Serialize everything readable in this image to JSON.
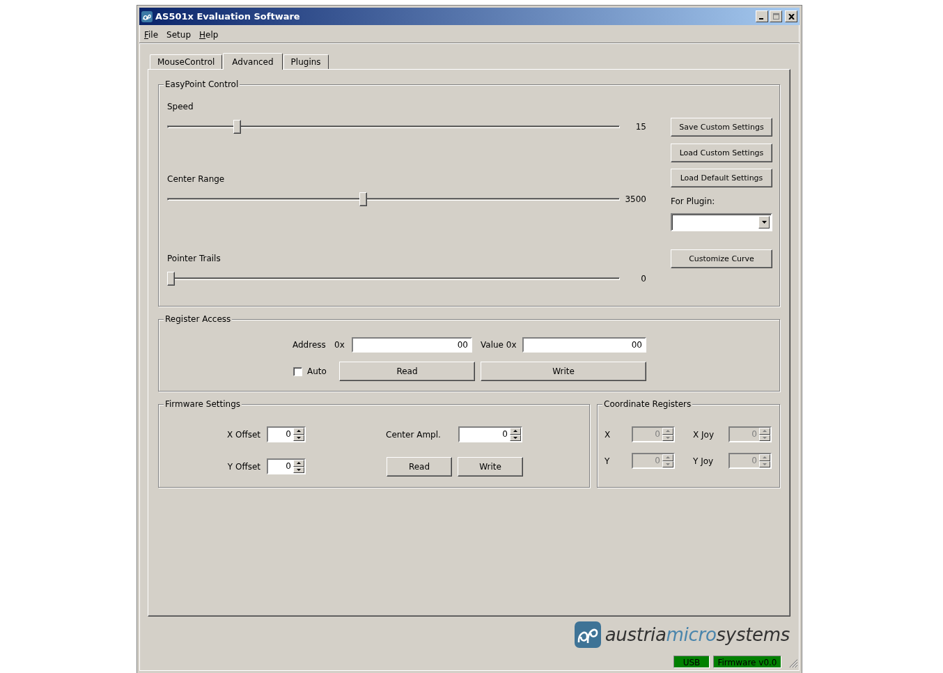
{
  "window": {
    "title": "AS501x Evaluation Software"
  },
  "menu": [
    {
      "label": "File",
      "underline_first": true
    },
    {
      "label": "Setup",
      "underline_first": false
    },
    {
      "label": "Help",
      "underline_first": true
    }
  ],
  "tabs": [
    {
      "label": "MouseControl",
      "selected": false
    },
    {
      "label": "Advanced",
      "selected": true
    },
    {
      "label": "Plugins",
      "selected": false
    }
  ],
  "easypoint": {
    "title": "EasyPoint Control",
    "sliders": [
      {
        "label": "Speed",
        "level": 0.148,
        "reading": "15"
      },
      {
        "label": "Center Range",
        "level": 0.432,
        "reading": "3500"
      },
      {
        "label": "Pointer Trails",
        "level": 0,
        "reading": "0"
      }
    ],
    "buttons": [
      "Save Custom Settings",
      "Load Custom Settings",
      "Load Default Settings"
    ],
    "plugin_label": "For Plugin:",
    "curve_button": "Customize Curve"
  },
  "register_access": {
    "title": "Register Access",
    "address_label": "Address",
    "address_prefix": "0x",
    "address_value": "00",
    "value_label": "Value 0x",
    "value_value": "00",
    "auto": {
      "label": "Auto",
      "checked": false
    },
    "read_button": "Read",
    "write_button": "Write"
  },
  "firmware": {
    "title": "Firmware Settings",
    "fields": [
      {
        "label": "X Offset",
        "value": "0",
        "disabled": false
      },
      {
        "label": "Y Offset",
        "value": "0",
        "disabled": false
      }
    ],
    "center": {
      "label": "Center Ampl.",
      "value": "0",
      "disabled": false
    },
    "read_button": "Read",
    "write_button": "Write"
  },
  "coordinates": {
    "title": "Coordinate Registers",
    "fields": [
      {
        "label": "X",
        "value": "0",
        "disabled": true
      },
      {
        "label": "X Joy",
        "value": "0",
        "disabled": true
      },
      {
        "label": "Y",
        "value": "0",
        "disabled": true
      },
      {
        "label": "Y Joy",
        "value": "0",
        "disabled": true
      }
    ]
  },
  "logo": {
    "parts": [
      "austria",
      "micro",
      "systems"
    ]
  },
  "status_bar": [
    "USB",
    "Firmware v0.0"
  ]
}
